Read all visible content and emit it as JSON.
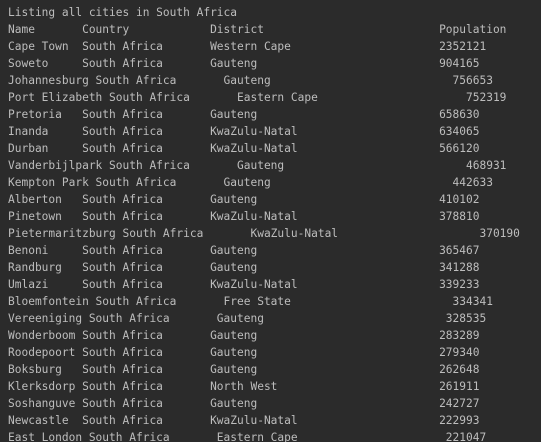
{
  "console": {
    "lines": [
      "Listing all cities in South Africa",
      "Name       Country            District                          Population",
      "Cape Town  South Africa       Western Cape                      2352121",
      "Soweto     South Africa       Gauteng                           904165",
      "Johannesburg South Africa       Gauteng                           756653",
      "Port Elizabeth South Africa       Eastern Cape                      752319",
      "Pretoria   South Africa       Gauteng                           658630",
      "Inanda     South Africa       KwaZulu-Natal                     634065",
      "Durban     South Africa       KwaZulu-Natal                     566120",
      "Vanderbijlpark South Africa       Gauteng                           468931",
      "Kempton Park South Africa       Gauteng                           442633",
      "Alberton   South Africa       Gauteng                           410102",
      "Pinetown   South Africa       KwaZulu-Natal                     378810",
      "Pietermaritzburg South Africa       KwaZulu-Natal                     370190",
      "Benoni     South Africa       Gauteng                           365467",
      "Randburg   South Africa       Gauteng                           341288",
      "Umlazi     South Africa       KwaZulu-Natal                     339233",
      "Bloemfontein South Africa       Free State                        334341",
      "Vereeniging South Africa       Gauteng                           328535",
      "Wonderboom South Africa       Gauteng                           283289",
      "Roodepoort South Africa       Gauteng                           279340",
      "Boksburg   South Africa       Gauteng                           262648",
      "Klerksdorp South Africa       North West                        261911",
      "Soshanguve South Africa       Gauteng                           242727",
      "Newcastle  South Africa       KwaZulu-Natal                     222993",
      "East London South Africa       Eastern Cape                      221047"
    ]
  }
}
